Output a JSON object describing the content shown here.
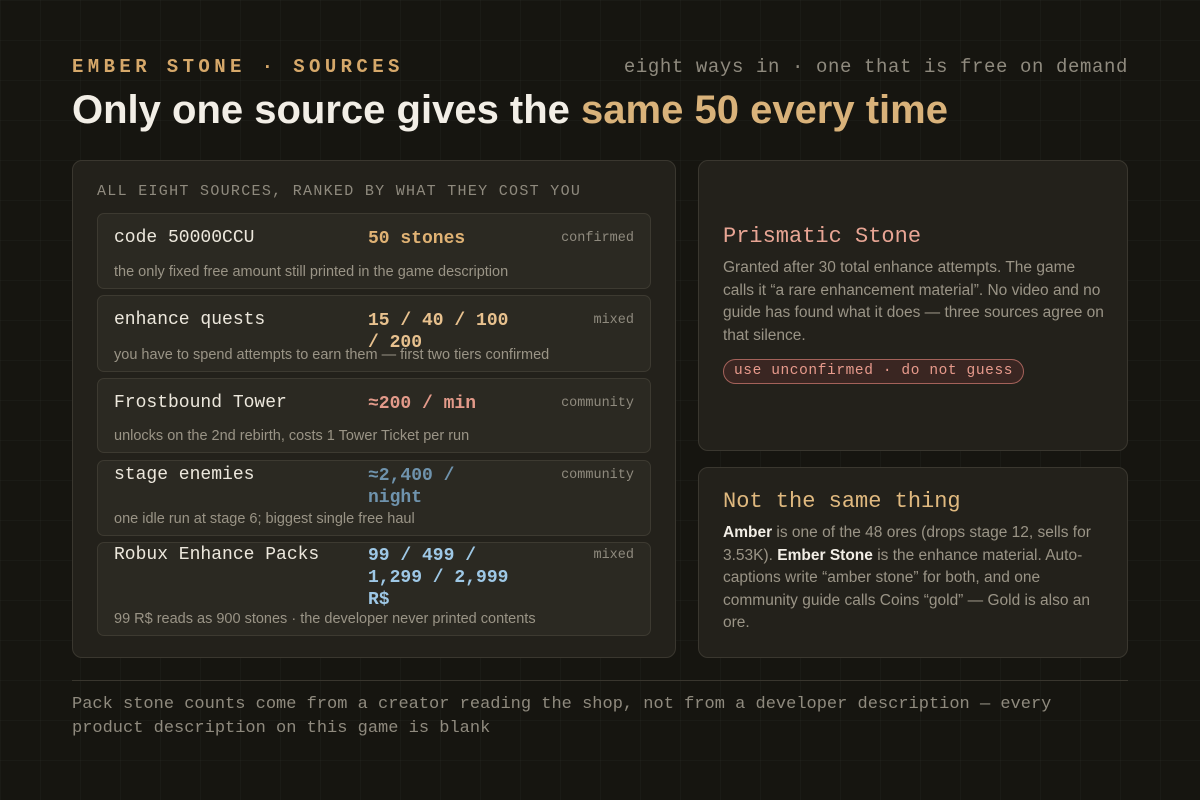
{
  "header": {
    "eyebrow": "EMBER STONE · SOURCES",
    "eyebrow_right": "eight ways in · one that is free on demand",
    "headline_prefix": "Only one source gives the ",
    "headline_accent": "same 50 every time"
  },
  "sources": {
    "caption": "ALL EIGHT SOURCES, RANKED BY WHAT THEY COST YOU",
    "rows": [
      {
        "name": "code 50000CCU",
        "amount": "50 stones",
        "tag": "confirmed",
        "note": "the only fixed free amount still printed in the game description",
        "amount_color": "#e0b274"
      },
      {
        "name": "enhance quests",
        "amount": "15 / 40 / 100 / 200",
        "tag": "mixed",
        "note": "you have to spend attempts to earn them — first two tiers confirmed",
        "amount_color": "#e8c18e"
      },
      {
        "name": "Frostbound Tower",
        "amount": "≈200 / min",
        "tag": "community",
        "note": "unlocks on the 2nd rebirth, costs 1 Tower Ticket per run",
        "amount_color": "#e39a8a"
      },
      {
        "name": "stage enemies",
        "amount": "≈2,400 / night",
        "tag": "community",
        "note": "one idle run at stage 6; biggest single free haul",
        "amount_color": "#6f93ad"
      },
      {
        "name": "Robux Enhance Packs",
        "amount": "99 / 499 / 1,299 / 2,999 R$",
        "tag": "mixed",
        "note": "99 R$ reads as 900 stones · the developer never printed contents",
        "amount_color": "#9ec8e6"
      }
    ]
  },
  "prismatic": {
    "title": "Prismatic Stone",
    "body": "Granted after 30 total enhance attempts. The game calls it “a rare enhancement material”. No video and no guide has found what it does — three sources agree on that silence.",
    "pill": "use unconfirmed · do not guess"
  },
  "not_same": {
    "title": "Not the same thing",
    "amber_word": "Amber",
    "text_1": " is one of the 48 ores (drops stage 12, sells for 3.53K). ",
    "ember_word": "Ember Stone",
    "text_2": " is the enhance material. Auto-captions write “amber stone” for both, and one community guide calls Coins “gold” — Gold is also an ore."
  },
  "footnote": "Pack stone counts come from a creator reading the shop, not from a developer description — every product description on this game is blank",
  "colors": {
    "accent_gold": "#d9b27a",
    "prismatic_title": "#e8a594",
    "not_same_title": "#e0b97f",
    "warning_pill": "#e79a8c"
  }
}
